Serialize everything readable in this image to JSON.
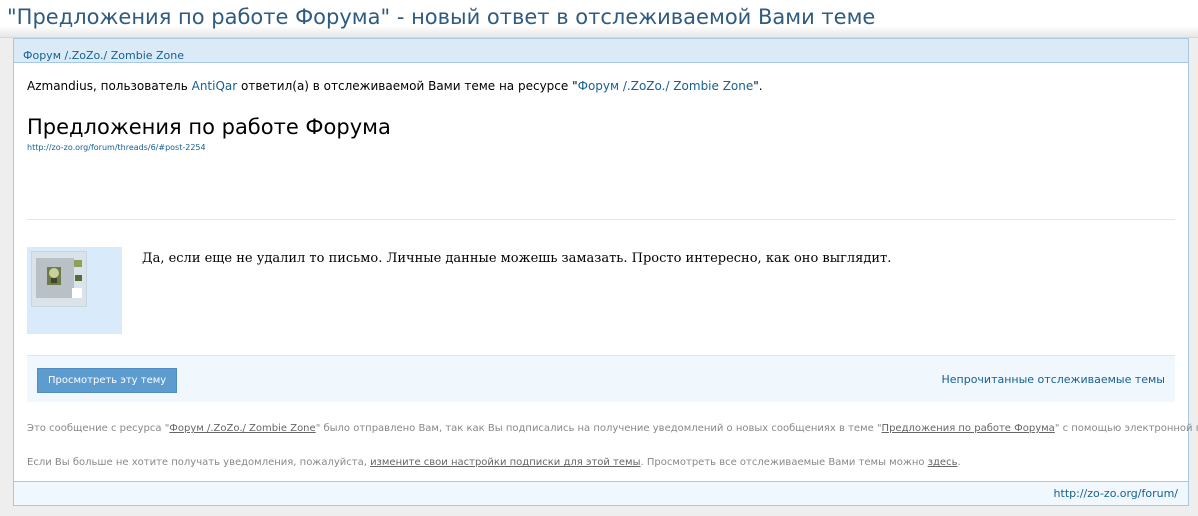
{
  "email_subject": "\"Предложения по работе Форума\" - новый ответ в отслеживаемой Вами теме",
  "header": {
    "board_title": "Форум /.ZoZo./ Zombie Zone"
  },
  "intro": {
    "recipient": "Azmandius",
    "text_before_user": ", пользователь ",
    "user": "AntiQar",
    "text_after_user": " ответил(а) в отслеживаемой Вами теме на ресурсе \"",
    "board_name": "Форум /.ZoZo./ Zombie Zone",
    "text_end": "\"."
  },
  "thread": {
    "title": "Предложения по работе Форума",
    "url": "http://zo-zo.org/forum/threads/6/#post-2254"
  },
  "post": {
    "message": "Да, если еще не удалил то письмо. Личные данные можешь замазать. Просто интересно, как оно выглядит."
  },
  "actions": {
    "view_thread": "Просмотреть эту тему",
    "unread_watched": "Непрочитанные отслеживаемые темы"
  },
  "footer": {
    "line1_a": "Это сообщение с ресурса \"",
    "line1_board": "Форум /.ZoZo./ Zombie Zone",
    "line1_b": "\" было отправлено Вам, так как Вы подписались на получение уведомлений о новых сообщениях в теме \"",
    "line1_thread": "Предложения по работе Форума",
    "line1_c": "\" с помощью электронной почты.",
    "line2_a": "Если Вы больше не хотите получать уведомления, пожалуйста, ",
    "line2_link": "измените свои настройки подписки для этой темы",
    "line2_b": ". Просмотреть все отслеживаемые Вами темы можно ",
    "line2_link2": "здесь",
    "line2_c": "."
  },
  "bottom": {
    "site_url": "http://zo-zo.org/forum/"
  },
  "colors": {
    "link": "#176093",
    "header_bg": "#dbeaf7",
    "button_bg": "#5d9ccf"
  }
}
